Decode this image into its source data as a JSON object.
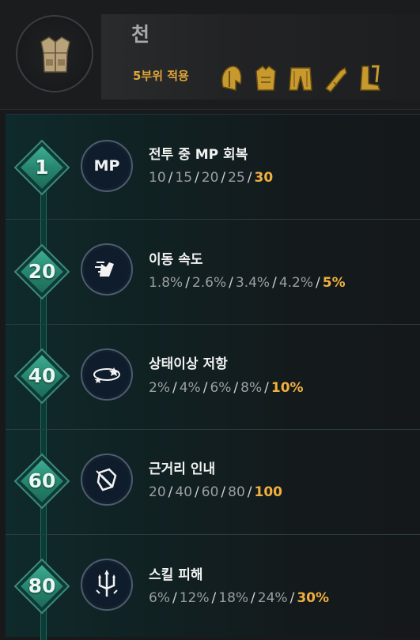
{
  "header": {
    "set_name": "천",
    "set_bonus": "5부위 적용",
    "armor_icon": "vest-icon",
    "parts": [
      "helmet-icon",
      "chest-icon",
      "pants-icon",
      "gloves-icon",
      "boots-icon"
    ],
    "accent_color": "#e0a53a"
  },
  "rows": [
    {
      "level": "1",
      "icon": "mp-icon",
      "icon_text": "MP",
      "title": "전투 중 MP 회복",
      "values": [
        "10",
        "15",
        "20",
        "25"
      ],
      "max": "30"
    },
    {
      "level": "20",
      "icon": "speed-icon",
      "title": "이동 속도",
      "values": [
        "1.8%",
        "2.6%",
        "3.4%",
        "4.2%"
      ],
      "max": "5%"
    },
    {
      "level": "40",
      "icon": "stun-resist-icon",
      "title": "상태이상 저항",
      "values": [
        "2%",
        "4%",
        "6%",
        "8%"
      ],
      "max": "10%"
    },
    {
      "level": "60",
      "icon": "shield-icon",
      "title": "근거리 인내",
      "values": [
        "20",
        "40",
        "60",
        "80"
      ],
      "max": "100"
    },
    {
      "level": "80",
      "icon": "trident-icon",
      "title": "스킬 피해",
      "values": [
        "6%",
        "12%",
        "18%",
        "24%"
      ],
      "max": "30%"
    }
  ],
  "colors": {
    "max_value": "#f0b03f",
    "level_diamond": "#3fae93"
  }
}
